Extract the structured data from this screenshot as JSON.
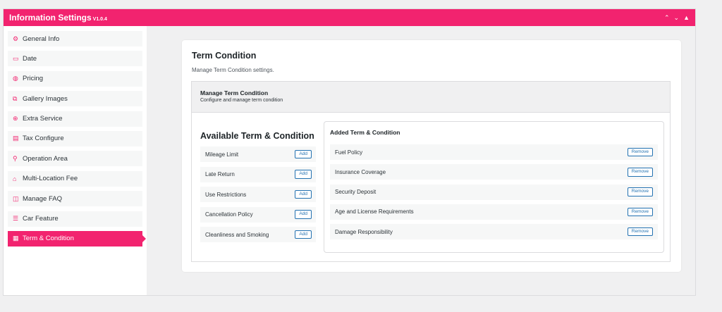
{
  "header": {
    "title": "Information Settings",
    "version": "V1.0.4"
  },
  "sidebar": {
    "items": [
      {
        "icon": "⚙",
        "label": "General Info"
      },
      {
        "icon": "▭",
        "label": "Date"
      },
      {
        "icon": "◍",
        "label": "Pricing"
      },
      {
        "icon": "⧉",
        "label": "Gallery Images"
      },
      {
        "icon": "⊕",
        "label": "Extra Service"
      },
      {
        "icon": "▤",
        "label": "Tax Configure"
      },
      {
        "icon": "⚲",
        "label": "Operation Area"
      },
      {
        "icon": "⌂",
        "label": "Multi-Location Fee"
      },
      {
        "icon": "◫",
        "label": "Manage FAQ"
      },
      {
        "icon": "☰",
        "label": "Car Feature"
      },
      {
        "icon": "▦",
        "label": "Term & Condition"
      }
    ]
  },
  "main": {
    "title": "Term Condition",
    "subtitle": "Manage Term Condition settings.",
    "section_title": "Manage Term Condition",
    "section_subtitle": "Configure and manage term condition",
    "available_title": "Available Term & Condition",
    "available": [
      {
        "label": "Mileage Limit",
        "button": "Add"
      },
      {
        "label": "Late Return",
        "button": "Add"
      },
      {
        "label": "Use Restrictions",
        "button": "Add"
      },
      {
        "label": "Cancellation Policy",
        "button": "Add"
      },
      {
        "label": "Cleanliness and Smoking",
        "button": "Add"
      }
    ],
    "added_title": "Added Term & Condition",
    "added": [
      {
        "label": "Fuel Policy",
        "button": "Remove"
      },
      {
        "label": "Insurance Coverage",
        "button": "Remove"
      },
      {
        "label": "Security Deposit",
        "button": "Remove"
      },
      {
        "label": "Age and License Requirements",
        "button": "Remove"
      },
      {
        "label": "Damage Responsibility",
        "button": "Remove"
      }
    ]
  },
  "colors": {
    "accent": "#f2236f",
    "button": "#2271b1"
  }
}
